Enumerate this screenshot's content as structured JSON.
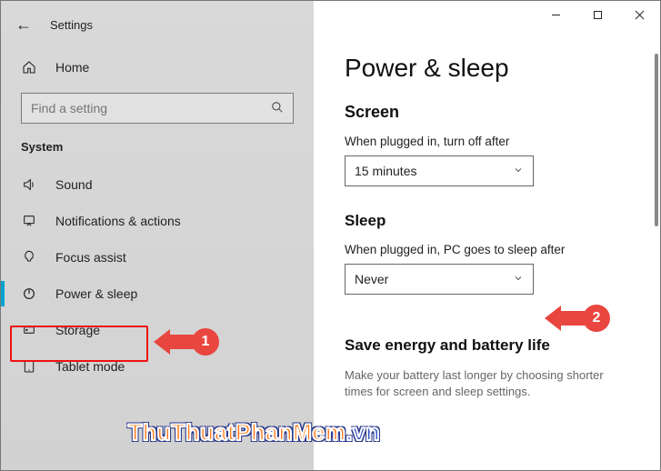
{
  "window": {
    "title": "Settings"
  },
  "sidebar": {
    "home": "Home",
    "search_placeholder": "Find a setting",
    "group": "System",
    "items": [
      {
        "label": "Sound"
      },
      {
        "label": "Notifications & actions"
      },
      {
        "label": "Focus assist"
      },
      {
        "label": "Power & sleep"
      },
      {
        "label": "Storage"
      },
      {
        "label": "Tablet mode"
      }
    ]
  },
  "page": {
    "title": "Power & sleep",
    "screen": {
      "heading": "Screen",
      "label": "When plugged in, turn off after",
      "value": "15 minutes"
    },
    "sleep": {
      "heading": "Sleep",
      "label": "When plugged in, PC goes to sleep after",
      "value": "Never"
    },
    "save": {
      "heading": "Save energy and battery life",
      "desc": "Make your battery last longer by choosing shorter times for screen and sleep settings."
    }
  },
  "annotations": {
    "callout1": "1",
    "callout2": "2"
  },
  "watermark": {
    "part1": "ThuThuatPhanMem",
    "part2": ".vn"
  }
}
